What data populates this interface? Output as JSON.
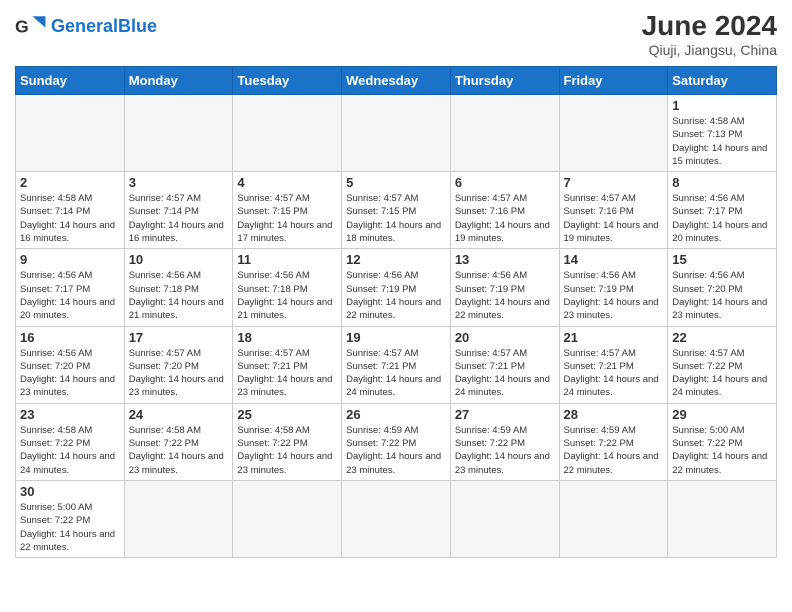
{
  "header": {
    "logo_general": "General",
    "logo_blue": "Blue",
    "month_title": "June 2024",
    "subtitle": "Qiuji, Jiangsu, China"
  },
  "days_of_week": [
    "Sunday",
    "Monday",
    "Tuesday",
    "Wednesday",
    "Thursday",
    "Friday",
    "Saturday"
  ],
  "weeks": [
    [
      {
        "day": "",
        "info": ""
      },
      {
        "day": "",
        "info": ""
      },
      {
        "day": "",
        "info": ""
      },
      {
        "day": "",
        "info": ""
      },
      {
        "day": "",
        "info": ""
      },
      {
        "day": "",
        "info": ""
      },
      {
        "day": "1",
        "info": "Sunrise: 4:58 AM\nSunset: 7:13 PM\nDaylight: 14 hours and 15 minutes."
      }
    ],
    [
      {
        "day": "2",
        "info": "Sunrise: 4:58 AM\nSunset: 7:14 PM\nDaylight: 14 hours and 16 minutes."
      },
      {
        "day": "3",
        "info": "Sunrise: 4:57 AM\nSunset: 7:14 PM\nDaylight: 14 hours and 16 minutes."
      },
      {
        "day": "4",
        "info": "Sunrise: 4:57 AM\nSunset: 7:15 PM\nDaylight: 14 hours and 17 minutes."
      },
      {
        "day": "5",
        "info": "Sunrise: 4:57 AM\nSunset: 7:15 PM\nDaylight: 14 hours and 18 minutes."
      },
      {
        "day": "6",
        "info": "Sunrise: 4:57 AM\nSunset: 7:16 PM\nDaylight: 14 hours and 19 minutes."
      },
      {
        "day": "7",
        "info": "Sunrise: 4:57 AM\nSunset: 7:16 PM\nDaylight: 14 hours and 19 minutes."
      },
      {
        "day": "8",
        "info": "Sunrise: 4:56 AM\nSunset: 7:17 PM\nDaylight: 14 hours and 20 minutes."
      }
    ],
    [
      {
        "day": "9",
        "info": "Sunrise: 4:56 AM\nSunset: 7:17 PM\nDaylight: 14 hours and 20 minutes."
      },
      {
        "day": "10",
        "info": "Sunrise: 4:56 AM\nSunset: 7:18 PM\nDaylight: 14 hours and 21 minutes."
      },
      {
        "day": "11",
        "info": "Sunrise: 4:56 AM\nSunset: 7:18 PM\nDaylight: 14 hours and 21 minutes."
      },
      {
        "day": "12",
        "info": "Sunrise: 4:56 AM\nSunset: 7:19 PM\nDaylight: 14 hours and 22 minutes."
      },
      {
        "day": "13",
        "info": "Sunrise: 4:56 AM\nSunset: 7:19 PM\nDaylight: 14 hours and 22 minutes."
      },
      {
        "day": "14",
        "info": "Sunrise: 4:56 AM\nSunset: 7:19 PM\nDaylight: 14 hours and 23 minutes."
      },
      {
        "day": "15",
        "info": "Sunrise: 4:56 AM\nSunset: 7:20 PM\nDaylight: 14 hours and 23 minutes."
      }
    ],
    [
      {
        "day": "16",
        "info": "Sunrise: 4:56 AM\nSunset: 7:20 PM\nDaylight: 14 hours and 23 minutes."
      },
      {
        "day": "17",
        "info": "Sunrise: 4:57 AM\nSunset: 7:20 PM\nDaylight: 14 hours and 23 minutes."
      },
      {
        "day": "18",
        "info": "Sunrise: 4:57 AM\nSunset: 7:21 PM\nDaylight: 14 hours and 23 minutes."
      },
      {
        "day": "19",
        "info": "Sunrise: 4:57 AM\nSunset: 7:21 PM\nDaylight: 14 hours and 24 minutes."
      },
      {
        "day": "20",
        "info": "Sunrise: 4:57 AM\nSunset: 7:21 PM\nDaylight: 14 hours and 24 minutes."
      },
      {
        "day": "21",
        "info": "Sunrise: 4:57 AM\nSunset: 7:21 PM\nDaylight: 14 hours and 24 minutes."
      },
      {
        "day": "22",
        "info": "Sunrise: 4:57 AM\nSunset: 7:22 PM\nDaylight: 14 hours and 24 minutes."
      }
    ],
    [
      {
        "day": "23",
        "info": "Sunrise: 4:58 AM\nSunset: 7:22 PM\nDaylight: 14 hours and 24 minutes."
      },
      {
        "day": "24",
        "info": "Sunrise: 4:58 AM\nSunset: 7:22 PM\nDaylight: 14 hours and 23 minutes."
      },
      {
        "day": "25",
        "info": "Sunrise: 4:58 AM\nSunset: 7:22 PM\nDaylight: 14 hours and 23 minutes."
      },
      {
        "day": "26",
        "info": "Sunrise: 4:59 AM\nSunset: 7:22 PM\nDaylight: 14 hours and 23 minutes."
      },
      {
        "day": "27",
        "info": "Sunrise: 4:59 AM\nSunset: 7:22 PM\nDaylight: 14 hours and 23 minutes."
      },
      {
        "day": "28",
        "info": "Sunrise: 4:59 AM\nSunset: 7:22 PM\nDaylight: 14 hours and 22 minutes."
      },
      {
        "day": "29",
        "info": "Sunrise: 5:00 AM\nSunset: 7:22 PM\nDaylight: 14 hours and 22 minutes."
      }
    ],
    [
      {
        "day": "30",
        "info": "Sunrise: 5:00 AM\nSunset: 7:22 PM\nDaylight: 14 hours and 22 minutes."
      },
      {
        "day": "",
        "info": ""
      },
      {
        "day": "",
        "info": ""
      },
      {
        "day": "",
        "info": ""
      },
      {
        "day": "",
        "info": ""
      },
      {
        "day": "",
        "info": ""
      },
      {
        "day": "",
        "info": ""
      }
    ]
  ]
}
